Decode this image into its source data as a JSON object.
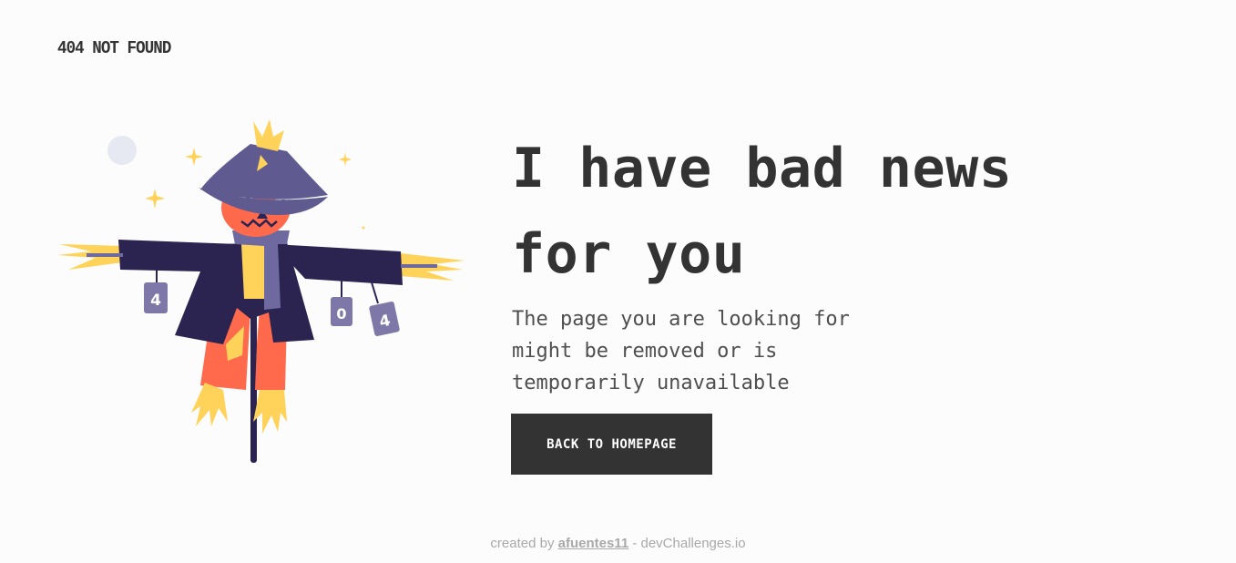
{
  "header": {
    "brand": "404 NOT FOUND"
  },
  "illustration": {
    "cans": [
      "4",
      "0",
      "4"
    ],
    "colors": {
      "hat": "#5f5a8f",
      "coat": "#2b2350",
      "face": "#ff6a4d",
      "straw": "#ffd35a",
      "scarf": "#6e6aa0",
      "pole": "#2b2350",
      "can": "#7e78a8",
      "moon": "#e6e9f2"
    }
  },
  "main": {
    "headline_line1": "I have bad news",
    "headline_line2": "for you",
    "subtext_line1": "The page you are looking for",
    "subtext_line2": "might be removed or is",
    "subtext_line3": "temporarily unavailable",
    "cta_label": "BACK TO HOMEPAGE"
  },
  "footer": {
    "prefix": "created by ",
    "author": "afuentes11",
    "suffix": " - devChallenges.io"
  }
}
